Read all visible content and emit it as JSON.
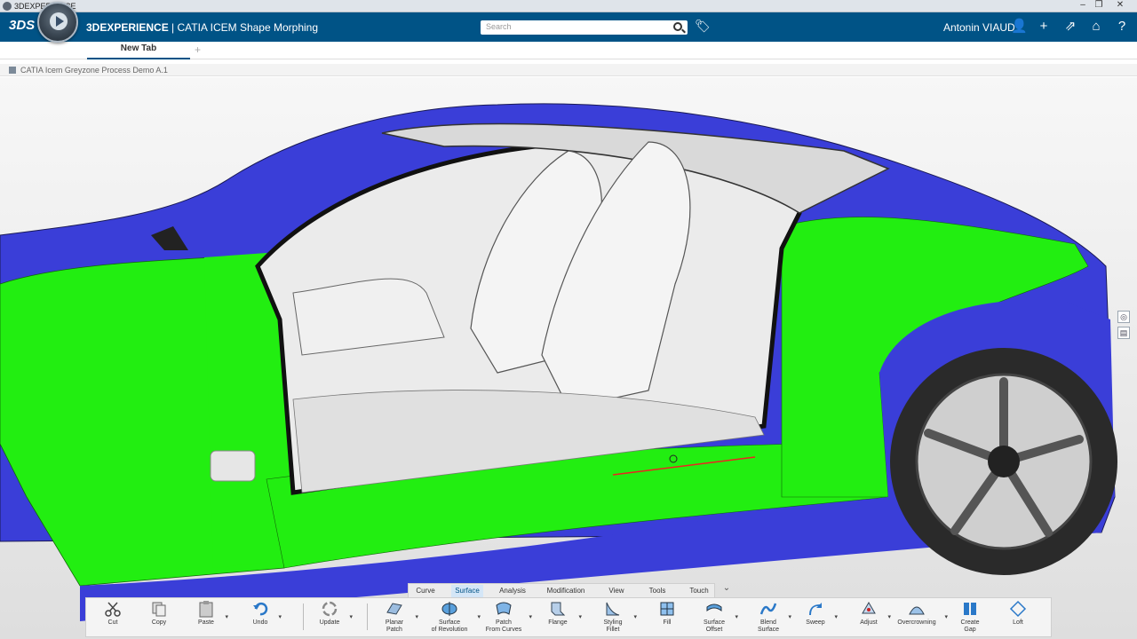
{
  "os_bar": {
    "title": "3DEXPERIENCE",
    "controls": [
      "–",
      "❐",
      "✕"
    ]
  },
  "header": {
    "app_title_bold": "3DEXPERIENCE",
    "app_title_rest": " | CATIA ICEM Shape Morphing",
    "search_placeholder": "Search",
    "user_name": "Antonin VIAUD",
    "icons": [
      "tag-icon",
      "user-icon",
      "plus-icon",
      "share-icon",
      "home-icon",
      "help-icon"
    ]
  },
  "tabs": {
    "active": "New Tab",
    "add": "+"
  },
  "document": {
    "title": "CATIA Icem Greyzone Process Demo A.1"
  },
  "section_tabs": [
    "Curve",
    "Surface",
    "Analysis",
    "Modification",
    "View",
    "Tools",
    "Touch"
  ],
  "section_active": "Surface",
  "toolbar_toggle": "⌄",
  "actions": {
    "cut": "Cut",
    "copy": "Copy",
    "paste": "Paste",
    "undo": "Undo",
    "update": "Update",
    "planar_patch_1": "Planar",
    "planar_patch_2": "Patch",
    "surface_rev_1": "Surface",
    "surface_rev_2": "of Revolution",
    "patch_curves_1": "Patch",
    "patch_curves_2": "From Curves",
    "flange": "Flange",
    "styling_fillet_1": "Styling",
    "styling_fillet_2": "Fillet",
    "fill": "Fill",
    "surface_offset_1": "Surface",
    "surface_offset_2": "Offset",
    "blend_surface_1": "Blend",
    "blend_surface_2": "Surface",
    "sweep": "Sweep",
    "adjust": "Adjust",
    "overcrowning": "Overcrowning",
    "create_gap_1": "Create",
    "create_gap_2": "Gap",
    "loft": "Loft"
  },
  "colors": {
    "header": "#005386",
    "body_blue": "#3b3fd6",
    "morph_green": "#22ee11",
    "interior": "#e4e4e4"
  }
}
